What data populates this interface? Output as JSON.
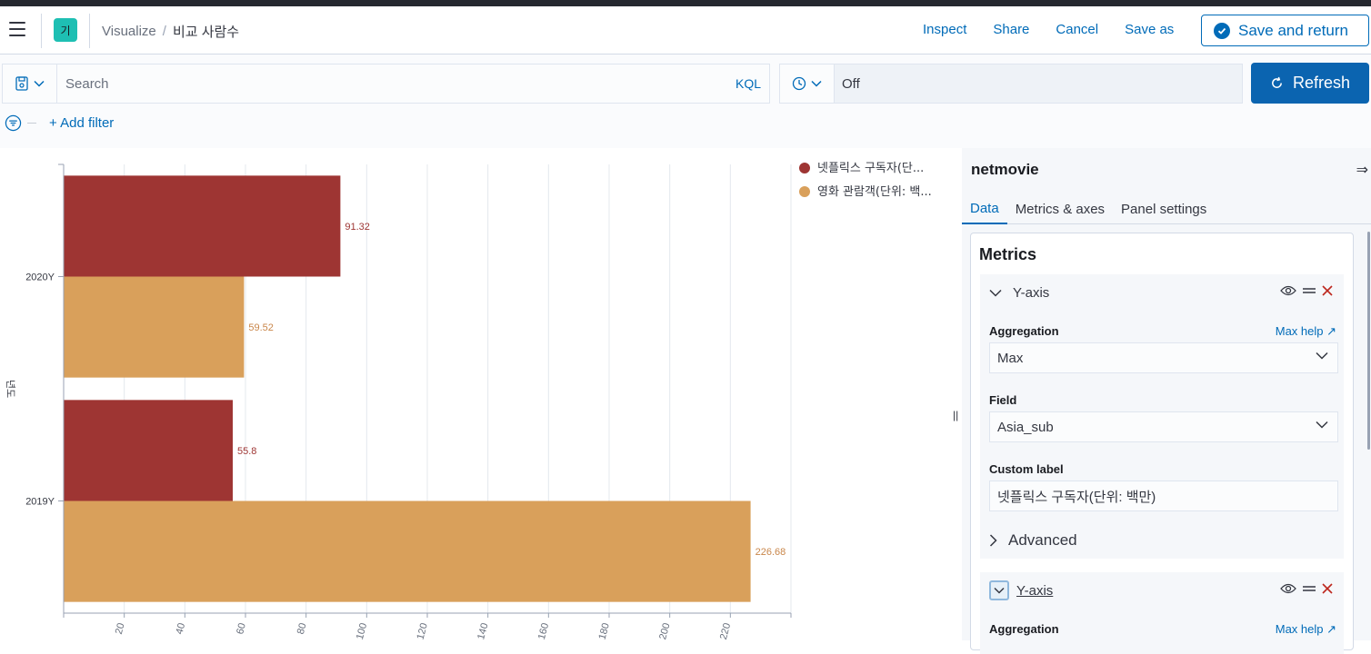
{
  "header": {
    "app_badge": "기",
    "breadcrumb_root": "Visualize",
    "breadcrumb_sep": "/",
    "breadcrumb_current": "비교 사람수",
    "actions": [
      "Inspect",
      "Share",
      "Cancel",
      "Save as"
    ],
    "save_return": "Save and return"
  },
  "query": {
    "search_placeholder": "Search",
    "language": "KQL",
    "time_value": "Off",
    "refresh_label": "Refresh",
    "add_filter": "+ Add filter"
  },
  "chart_data": {
    "type": "bar",
    "orientation": "horizontal",
    "categories": [
      "2020Y",
      "2019Y"
    ],
    "series": [
      {
        "name": "넷플릭스 구독자(단...",
        "color": "#9e3533",
        "values": [
          91.32,
          55.8
        ]
      },
      {
        "name": "영화 관람객(단위: 백...",
        "color": "#d9a05b",
        "values": [
          59.52,
          226.68
        ]
      }
    ],
    "xlim": [
      0,
      240
    ],
    "x_ticks": [
      20,
      40,
      60,
      80,
      100,
      120,
      140,
      160,
      180,
      200,
      220
    ],
    "ylabel": "년도",
    "grid": true,
    "legend_position": "right"
  },
  "panel": {
    "title": "netmovie",
    "tabs": [
      "Data",
      "Metrics & axes",
      "Panel settings"
    ],
    "metrics_title": "Metrics",
    "metric1": {
      "label": "Y-axis",
      "aggregation_label": "Aggregation",
      "help": "Max help",
      "aggregation_value": "Max",
      "field_label": "Field",
      "field_value": "Asia_sub",
      "custom_label_label": "Custom label",
      "custom_label_value": "넷플릭스 구독자(단위: 백만)",
      "advanced": "Advanced"
    },
    "metric2": {
      "label": "Y-axis",
      "aggregation_label": "Aggregation",
      "help": "Max help"
    }
  }
}
